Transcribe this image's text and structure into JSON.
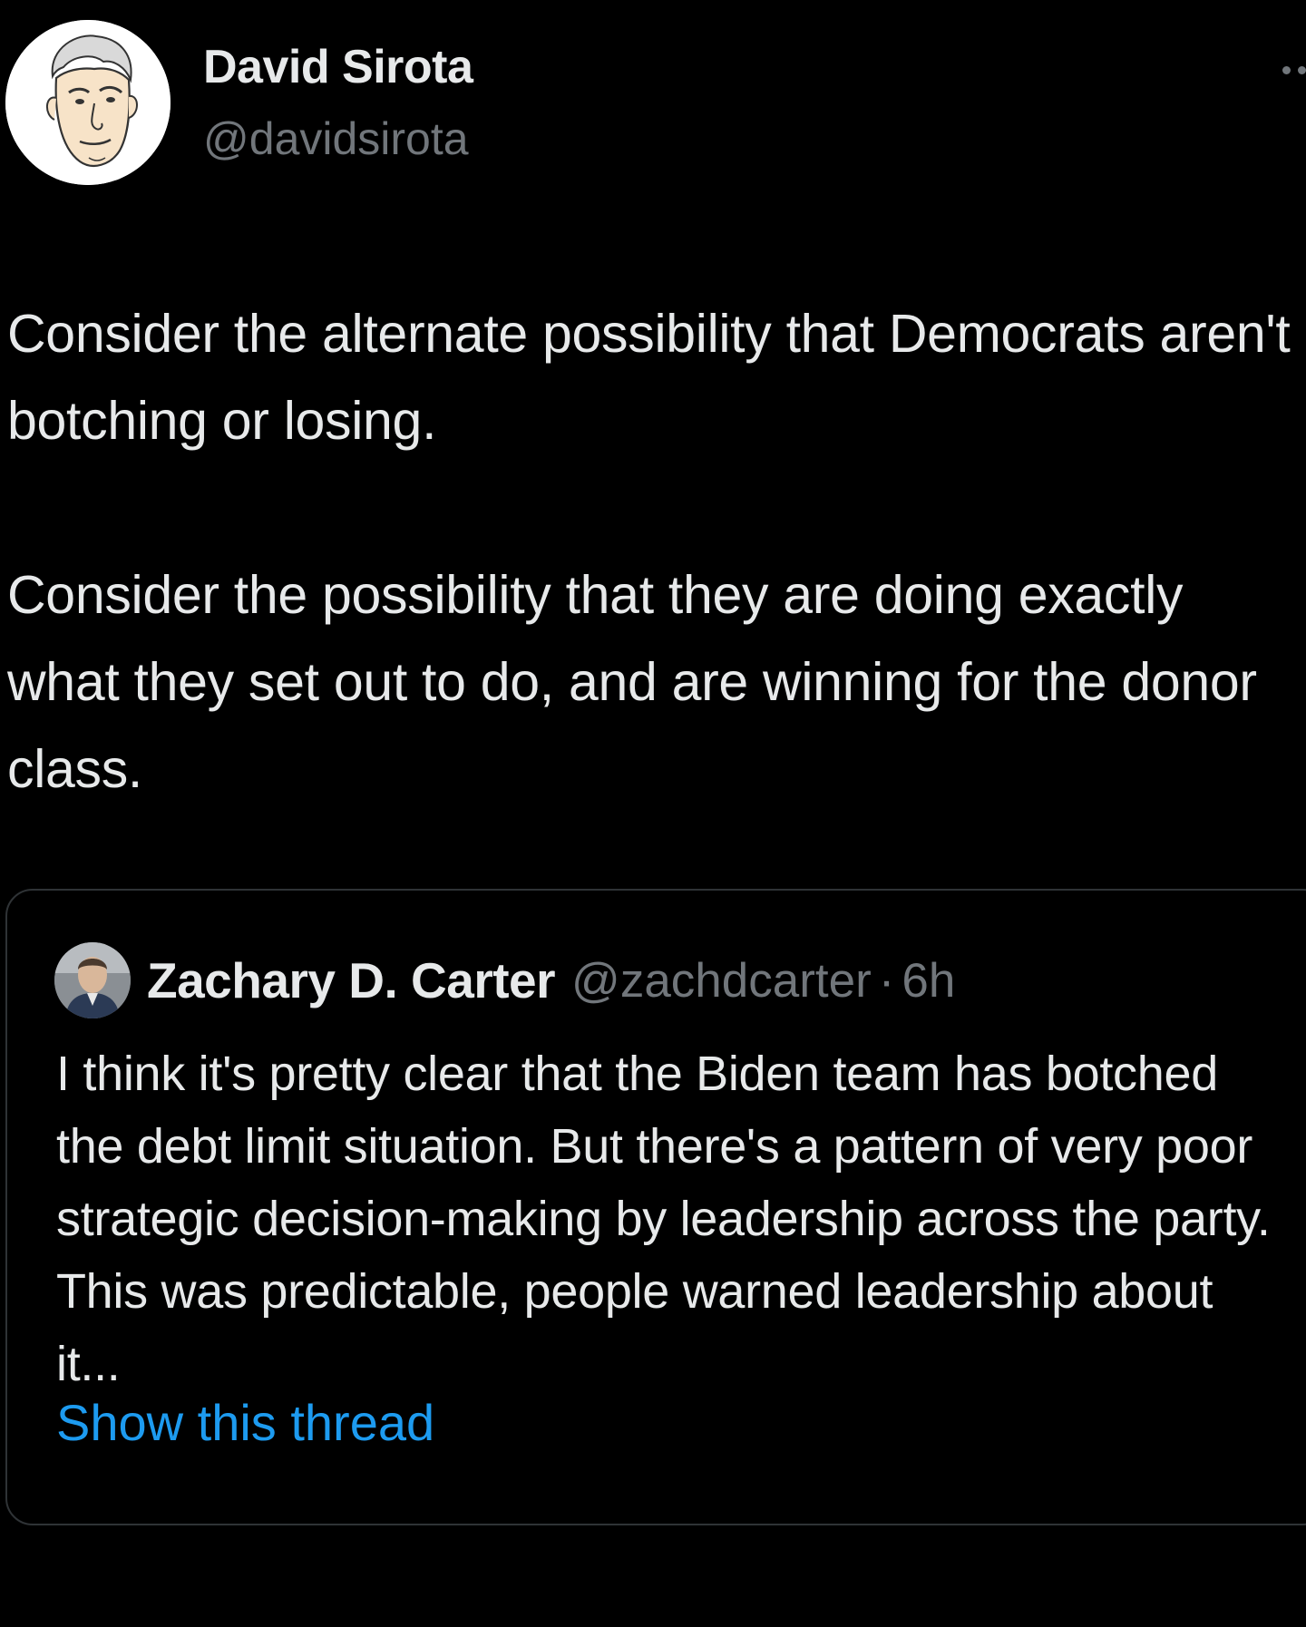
{
  "author": {
    "display_name": "David Sirota",
    "handle": "@davidsirota"
  },
  "tweet": {
    "paragraphs": [
      "Consider the alternate possibility that Democrats aren't botching or losing.",
      "Consider the possibility that they are doing exactly what they set out to do, and are winning for the donor class."
    ]
  },
  "quoted_tweet": {
    "display_name": "Zachary D. Carter",
    "handle": "@zachdcarter",
    "separator": "·",
    "time": "6h",
    "text": "I think it's pretty clear that the Biden team has botched the debt limit situation. But there's a pattern of very poor strategic decision-making by leadership across the party. This was predictable, people warned leadership about it...",
    "show_thread_label": "Show this thread"
  },
  "icons": {
    "more": "more-horizontal-icon"
  },
  "colors": {
    "background": "#000000",
    "primary_text": "#e7e9ea",
    "secondary_text": "#71767b",
    "link": "#1d9bf0",
    "border": "#2f3336"
  }
}
